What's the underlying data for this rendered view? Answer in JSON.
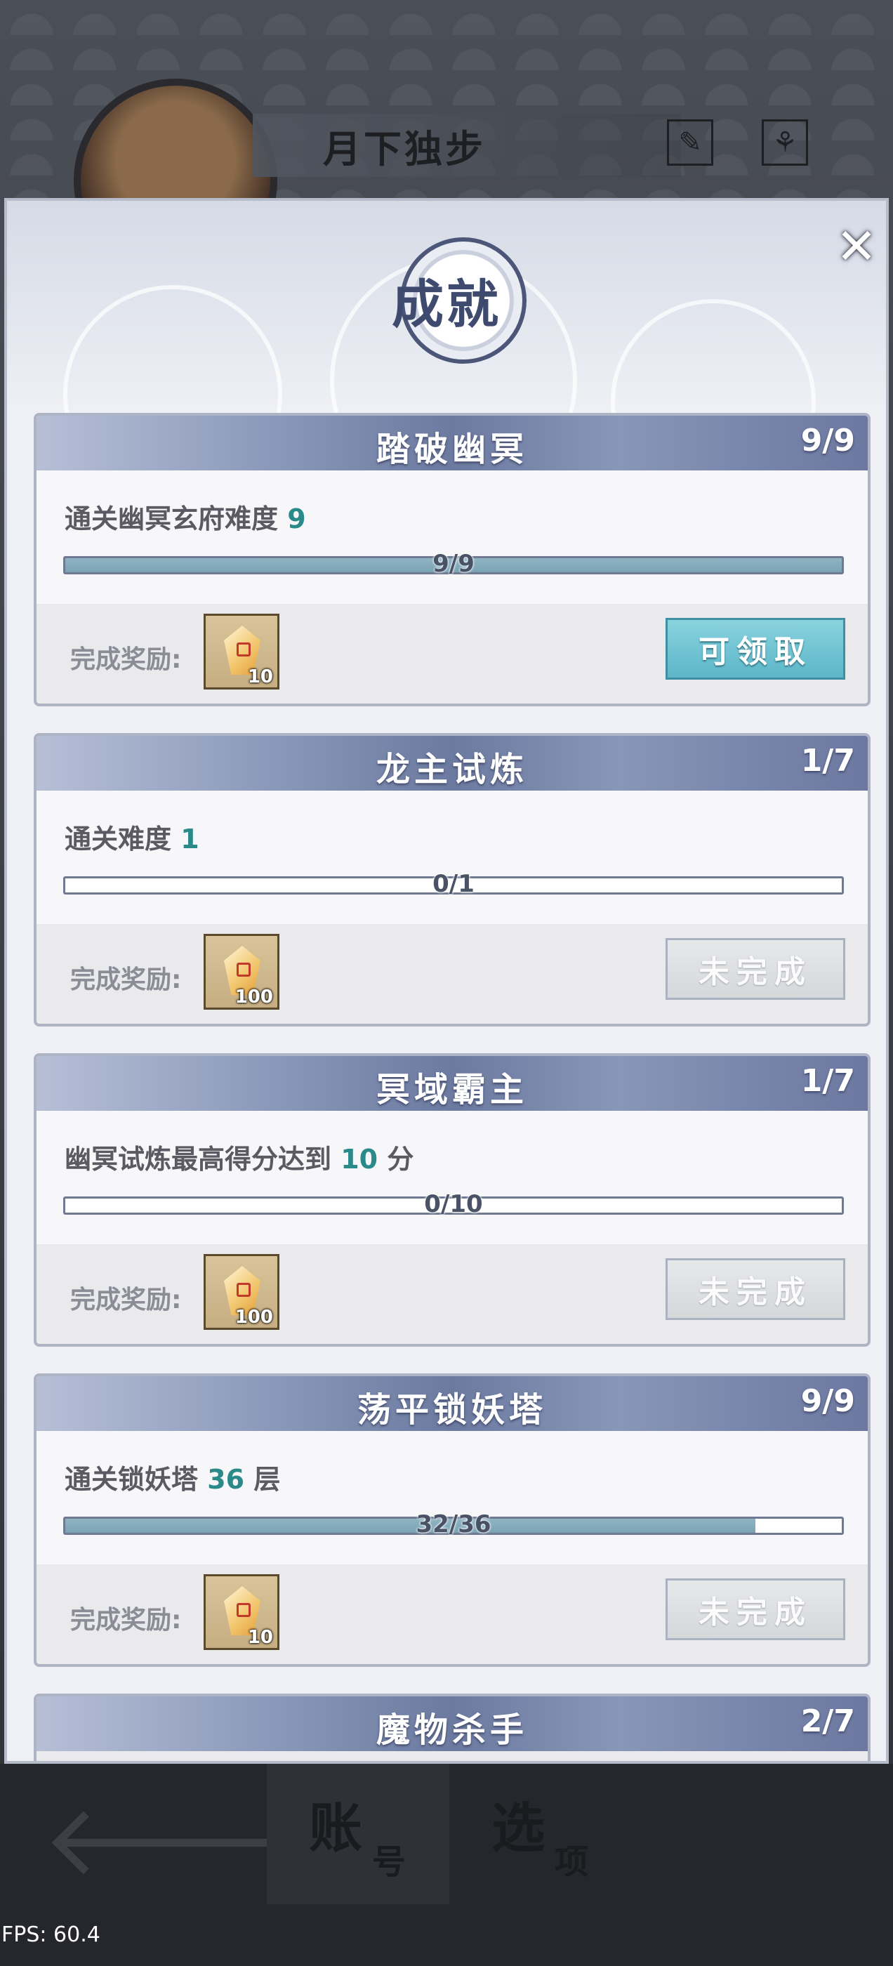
{
  "profile": {
    "player_name": "月下独步",
    "icons": [
      "brush-icon",
      "flower-icon"
    ]
  },
  "modal": {
    "title": "成就",
    "close_symbol": "✕"
  },
  "achievements": [
    {
      "title": "踏破幽冥",
      "count": "9/9",
      "desc_prefix": "通关幽冥玄府难度 ",
      "desc_value": "9",
      "desc_suffix": "",
      "progress_text": "9/9",
      "progress": 1.0,
      "reward_label": "完成奖励:",
      "reward_qty": "10",
      "reward_icon": "gem-icon",
      "button_label": "可领取",
      "button_state": "claimable"
    },
    {
      "title": "龙主试炼",
      "count": "1/7",
      "desc_prefix": "通关难度 ",
      "desc_value": "1",
      "desc_suffix": "",
      "progress_text": "0/1",
      "progress": 0.0,
      "reward_label": "完成奖励:",
      "reward_qty": "100",
      "reward_icon": "gem-icon",
      "button_label": "未完成",
      "button_state": "incomplete"
    },
    {
      "title": "冥域霸主",
      "count": "1/7",
      "desc_prefix": "幽冥试炼最高得分达到 ",
      "desc_value": "10",
      "desc_suffix": " 分",
      "progress_text": "0/10",
      "progress": 0.0,
      "reward_label": "完成奖励:",
      "reward_qty": "100",
      "reward_icon": "gem-icon",
      "button_label": "未完成",
      "button_state": "incomplete"
    },
    {
      "title": "荡平锁妖塔",
      "count": "9/9",
      "desc_prefix": "通关锁妖塔 ",
      "desc_value": "36",
      "desc_suffix": " 层",
      "progress_text": "32/36",
      "progress": 0.889,
      "reward_label": "完成奖励:",
      "reward_qty": "10",
      "reward_icon": "gem-icon",
      "button_label": "未完成",
      "button_state": "incomplete"
    },
    {
      "title": "魔物杀手",
      "count": "2/7"
    }
  ],
  "bottom_nav": {
    "back_icon": "back-arrow-icon",
    "tab_account_big": "账",
    "tab_account_small": "号",
    "tab_options_big": "选",
    "tab_options_small": "项"
  },
  "fps": "FPS: 60.4"
}
